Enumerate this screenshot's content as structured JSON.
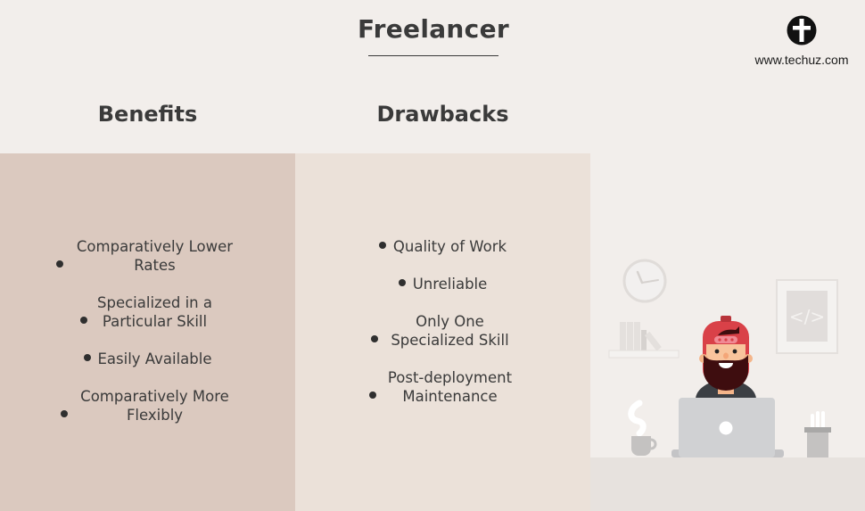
{
  "header": {
    "title": "Freelancer",
    "logo": {
      "icon": "techuz-logo-icon",
      "url_text": "www.techuz.com"
    }
  },
  "columns": {
    "benefits": {
      "heading": "Benefits",
      "items": [
        "Comparatively Lower Rates",
        "Specialized in a Particular Skill",
        "Easily Available",
        "Comparatively More Flexibly"
      ]
    },
    "drawbacks": {
      "heading": "Drawbacks",
      "items": [
        "Quality of Work",
        "Unreliable",
        "Only One Specialized Skill",
        "Post-deployment Maintenance"
      ]
    }
  },
  "illustration": {
    "elements": [
      "clock-icon",
      "bookshelf-icon",
      "code-frame-icon",
      "developer-avatar",
      "laptop-icon",
      "coffee-mug-icon",
      "pencil-holder-icon"
    ],
    "code_symbol": "</>"
  },
  "colors": {
    "background": "#f2eeeb",
    "benefits_panel": "#dbc9bf",
    "drawbacks_panel": "#ebe1d9",
    "text": "#3a3a3a",
    "cap_red": "#d94148",
    "beard": "#3e0d0f"
  }
}
